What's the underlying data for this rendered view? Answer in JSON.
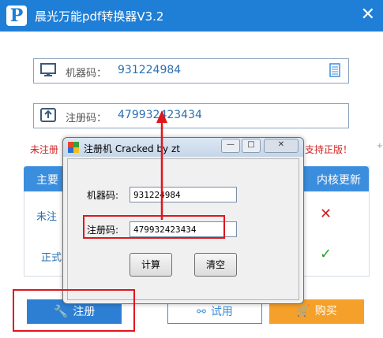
{
  "window": {
    "title": "晨光万能pdf转换器V3.2",
    "logo_letter": "P",
    "close_glyph": "✕"
  },
  "fields": {
    "machine_label": "机器码：",
    "machine_value": "931224984",
    "reg_label": "注册码：",
    "reg_value": "479932423434"
  },
  "notices": {
    "left": "未注册",
    "right": "支持正版！"
  },
  "panel": {
    "head_left": "主要",
    "head_right": "内核更新",
    "row1_left": "未注",
    "row2_left": "正式",
    "row1_mark": "✕",
    "row2_mark": "✓"
  },
  "buttons": {
    "register": "注册",
    "trial": "试用",
    "buy": "购买"
  },
  "dialog": {
    "caption": "注册机 Cracked by zt",
    "machine_label": "机器码:",
    "machine_value": "931224984",
    "reg_label": "注册码:",
    "reg_value": "479932423434",
    "calc_label": "计算",
    "clear_label": "清空",
    "min_glyph": "—",
    "max_glyph": "□",
    "close_glyph": "✕"
  },
  "colors": {
    "brand_blue": "#1f7fd6",
    "annotation_red": "#e0151d",
    "buy_orange": "#f5a02a"
  }
}
